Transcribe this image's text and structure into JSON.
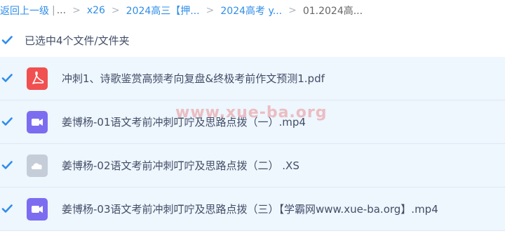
{
  "breadcrumb": {
    "back": "返回上一级",
    "ellipsis": "...",
    "items": [
      "x26",
      "2024高三【押...",
      "2024高考 y..."
    ],
    "current": "01.2024高..."
  },
  "selection": {
    "label": "已选中4个文件/文件夹"
  },
  "files": [
    {
      "name": "冲刺1、诗歌鉴赏高频考向复盘&终极考前作文预测1.pdf",
      "icon": "pdf-icon",
      "color": "#f0504f"
    },
    {
      "name": "姜博杨-01语文考前冲刺叮咛及思路点拨（一）.mp4",
      "icon": "video-icon",
      "color": "#7c6df0"
    },
    {
      "name": "姜博杨-02语文考前冲刺叮咛及思路点拨（二）  .XS",
      "icon": "cloud-file-icon",
      "color": "#c5ced8"
    },
    {
      "name": "姜博杨-03语文考前冲刺叮咛及思路点拨（三）【学霸网www.xue-ba.org】.mp4",
      "icon": "video-icon",
      "color": "#7c6df0"
    }
  ],
  "watermark": "www.xue-ba.org",
  "colors": {
    "link": "#2f8ee8",
    "row_bg": "#eef6fe",
    "check": "#2f8ee8"
  }
}
